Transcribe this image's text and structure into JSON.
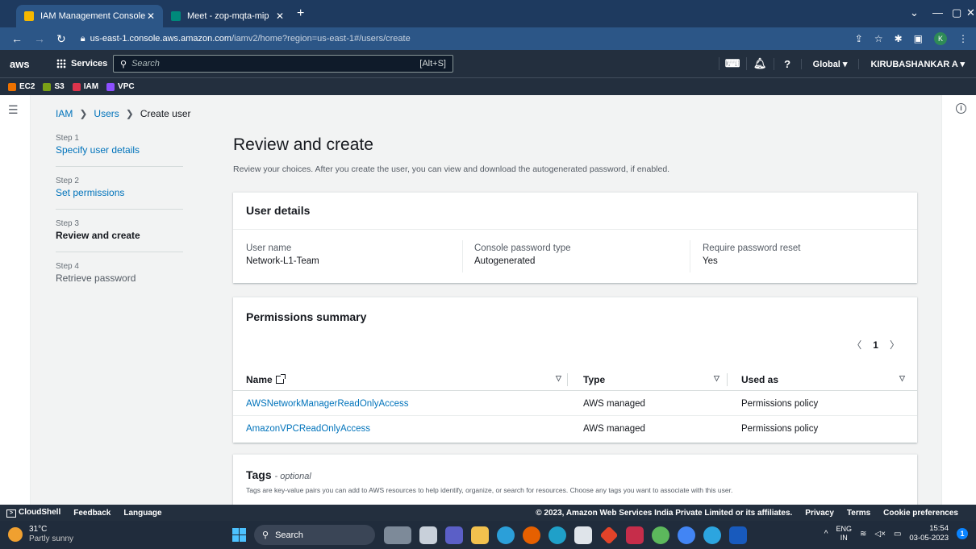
{
  "browser": {
    "tabs": [
      {
        "title": "IAM Management Console",
        "close": "✕"
      },
      {
        "title": "Meet - zop-mqta-mip",
        "close": "✕"
      }
    ],
    "new_tab": "+",
    "url_domain": "us-east-1.console.aws.amazon.com",
    "url_path": "/iamv2/home?region=us-east-1#/users/create",
    "profile_initial": "K"
  },
  "aws_nav": {
    "logo": "aws",
    "services": "Services",
    "search_placeholder": "Search",
    "search_hint": "[Alt+S]",
    "region": "Global ▾",
    "account": "KIRUBASHANKAR A ▾"
  },
  "favorites": [
    {
      "label": "EC2",
      "color": "#ed7100"
    },
    {
      "label": "S3",
      "color": "#7aa116"
    },
    {
      "label": "IAM",
      "color": "#dd344c"
    },
    {
      "label": "VPC",
      "color": "#8c4fff"
    }
  ],
  "breadcrumb": {
    "iam": "IAM",
    "users": "Users",
    "current": "Create user",
    "sep": "❯"
  },
  "steps": [
    {
      "num": "Step 1",
      "label": "Specify user details"
    },
    {
      "num": "Step 2",
      "label": "Set permissions"
    },
    {
      "num": "Step 3",
      "label": "Review and create"
    },
    {
      "num": "Step 4",
      "label": "Retrieve password"
    }
  ],
  "page": {
    "title": "Review and create",
    "description": "Review your choices. After you create the user, you can view and download the autogenerated password, if enabled."
  },
  "user_details": {
    "title": "User details",
    "fields": [
      {
        "key": "User name",
        "value": "Network-L1-Team"
      },
      {
        "key": "Console password type",
        "value": "Autogenerated"
      },
      {
        "key": "Require password reset",
        "value": "Yes"
      }
    ]
  },
  "permissions": {
    "title": "Permissions summary",
    "page": "1",
    "columns": [
      "Name",
      "Type",
      "Used as"
    ],
    "rows": [
      {
        "name": "AWSNetworkManagerReadOnlyAccess",
        "type": "AWS managed",
        "used_as": "Permissions policy"
      },
      {
        "name": "AmazonVPCReadOnlyAccess",
        "type": "AWS managed",
        "used_as": "Permissions policy"
      }
    ]
  },
  "tags": {
    "title": "Tags",
    "optional": "- optional",
    "description": "Tags are key-value pairs you can add to AWS resources to help identify, organize, or search for resources. Choose any tags you want to associate with this user."
  },
  "footer": {
    "cloudshell": "CloudShell",
    "feedback": "Feedback",
    "language": "Language",
    "copyright": "© 2023, Amazon Web Services India Private Limited or its affiliates.",
    "privacy": "Privacy",
    "terms": "Terms",
    "cookies": "Cookie preferences"
  },
  "taskbar": {
    "temp": "31°C",
    "weather": "Partly sunny",
    "search": "Search",
    "lang1": "ENG",
    "lang2": "IN",
    "time": "15:54",
    "date": "03-05-2023",
    "notif": "1"
  }
}
